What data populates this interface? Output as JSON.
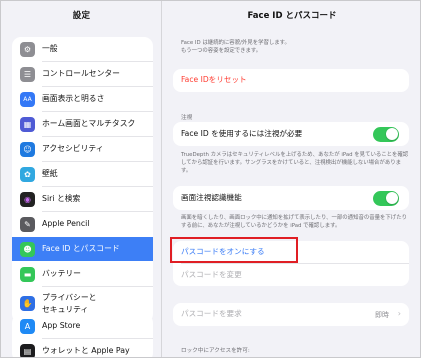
{
  "sidebar": {
    "title": "設定",
    "items": [
      {
        "label": "一般",
        "icon": "gear-icon",
        "color": "#8e8e93",
        "glyph": "⚙"
      },
      {
        "label": "コントロールセンター",
        "icon": "control-center-icon",
        "color": "#8e8e93",
        "glyph": "☰"
      },
      {
        "label": "画面表示と明るさ",
        "icon": "display-icon",
        "color": "#3478f6",
        "glyph": "AA"
      },
      {
        "label": "ホーム画面とマルチタスク",
        "icon": "home-screen-icon",
        "color": "#4f5bd5",
        "glyph": "▦"
      },
      {
        "label": "アクセシビリティ",
        "icon": "accessibility-icon",
        "color": "#1f7ae0",
        "glyph": "☺"
      },
      {
        "label": "壁紙",
        "icon": "wallpaper-icon",
        "color": "#31a8e0",
        "glyph": "✿"
      },
      {
        "label": "Siri と検索",
        "icon": "siri-icon",
        "color": "#222222",
        "glyph": "◉"
      },
      {
        "label": "Apple Pencil",
        "icon": "pencil-icon",
        "color": "#5a5a5e",
        "glyph": "✎"
      },
      {
        "label": "Face ID とパスコード",
        "icon": "face-id-icon",
        "color": "#34c759",
        "glyph": "☻"
      },
      {
        "label": "バッテリー",
        "icon": "battery-icon",
        "color": "#34c759",
        "glyph": "▬"
      },
      {
        "label": "プライバシーと",
        "label2": "セキュリティ",
        "icon": "privacy-hand-icon",
        "color": "#2f6fe4",
        "glyph": "✋"
      },
      {
        "label": "App Store",
        "icon": "app-store-icon",
        "color": "#1f8af5",
        "glyph": "A"
      },
      {
        "label": "ウォレットと Apple Pay",
        "icon": "wallet-icon",
        "color": "#1c1c1e",
        "glyph": "▤"
      }
    ]
  },
  "detail": {
    "title": "Face ID とパスコード",
    "top_note": "Face ID は継続的に容貌/外見を学習します。\nもう一つの容姿を設定できます。",
    "reset_label": "Face IDをリセット",
    "section_attention": "注視",
    "require_attention_label": "Face ID を使用するには注視が必要",
    "require_attention_on": true,
    "require_attention_note": "TrueDepth カメラはセキュリティレベルを上げるため、あなたが iPad を見ていることを確認してから認証を行います。サングラスをかけていると、注視検出が機能しない場合があります。",
    "attention_aware_label": "画面注視認識機能",
    "attention_aware_on": true,
    "attention_aware_note": "画面を暗くしたり、画面ロック中に通知を拡げて表示したり、一部の通知音の音量を下げたりする前に、あなたが注視しているかどうかを iPad で確認します。",
    "passcode_on_label": "パスコードをオンにする",
    "passcode_change_label": "パスコードを変更",
    "require_passcode_label": "パスコードを要求",
    "require_passcode_value": "即時",
    "locked_access_label": "ロック中にアクセスを許可:"
  },
  "colors": {
    "accent": "#3478f6",
    "reset_red": "#ff3b30",
    "toggle_green": "#34c759",
    "highlight_red": "#e01e24"
  }
}
